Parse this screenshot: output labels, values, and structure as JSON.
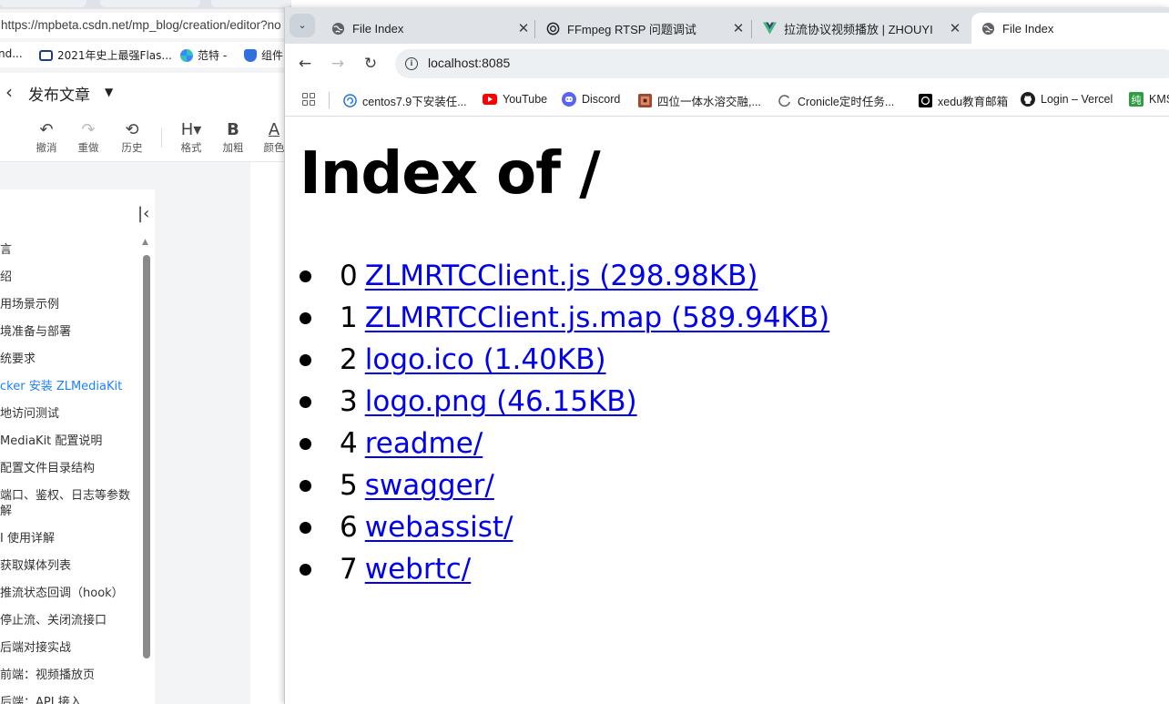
{
  "background_window": {
    "url": "https://mpbeta.csdn.net/mp_blog/creation/editor?no",
    "bookmarks": [
      {
        "label": "nd...",
        "icon": "bookmark-icon"
      },
      {
        "label": "2021年史上最强Flas...",
        "icon": "bilibili-icon"
      },
      {
        "label": "范特 -",
        "icon": "pinwheel-icon"
      },
      {
        "label": "组件",
        "icon": "shield-icon"
      }
    ],
    "header": {
      "title": "发布文章"
    },
    "toolbar": [
      {
        "label": "撤消",
        "icon": "undo-icon",
        "glyph": "↶"
      },
      {
        "label": "重做",
        "icon": "redo-icon",
        "glyph": "↷"
      },
      {
        "label": "历史",
        "icon": "history-icon",
        "glyph": "⟲"
      },
      {
        "label": "格式",
        "icon": "heading-icon",
        "glyph": "H▾"
      },
      {
        "label": "加粗",
        "icon": "bold-icon",
        "glyph": "B"
      },
      {
        "label": "颜色",
        "icon": "font-color-icon",
        "glyph": "A"
      }
    ],
    "outline": [
      "言",
      "绍",
      "用场景示例",
      "境准备与部署",
      "统要求",
      "cker 安装 ZLMediaKit",
      "地访问测试",
      "MediaKit 配置说明",
      "配置文件目录结构",
      "端口、鉴权、日志等参数解",
      "I 使用详解",
      "获取媒体列表",
      "推流状态回调（hook）",
      "停止流、关闭流接口",
      "后端对接实战",
      "前端：视频播放页",
      "后端：API 接入"
    ],
    "outline_active_index": 5
  },
  "browser": {
    "tabs": [
      {
        "title": "File Index",
        "icon": "globe-icon",
        "active": false
      },
      {
        "title": "FFmpeg RTSP 问题调试",
        "icon": "openai-icon",
        "active": false
      },
      {
        "title": "拉流协议视频播放 | ZHOUYI",
        "icon": "vue-icon",
        "active": false
      },
      {
        "title": "File Index",
        "icon": "globe-icon",
        "active": true
      }
    ],
    "url": "localhost:8085",
    "bookmarks": [
      {
        "label": "centos7.9下安装任...",
        "icon": "centos-icon"
      },
      {
        "label": "YouTube",
        "icon": "youtube-icon"
      },
      {
        "label": "Discord",
        "icon": "discord-icon"
      },
      {
        "label": "四位一体水溶交融,...",
        "icon": "image-icon"
      },
      {
        "label": "Cronicle定时任务...",
        "icon": "loading-icon"
      },
      {
        "label": "xedu教育邮箱",
        "icon": "openai-icon"
      },
      {
        "label": "Login – Vercel",
        "icon": "github-icon"
      },
      {
        "label": "KMS",
        "icon": "kms-icon"
      }
    ]
  },
  "page": {
    "heading": "Index of /",
    "files": [
      {
        "index": "0",
        "name": "ZLMRTCClient.js (298.98KB)"
      },
      {
        "index": "1",
        "name": "ZLMRTCClient.js.map (589.94KB)"
      },
      {
        "index": "2",
        "name": "logo.ico (1.40KB)"
      },
      {
        "index": "3",
        "name": "logo.png (46.15KB)"
      },
      {
        "index": "4",
        "name": "readme/"
      },
      {
        "index": "5",
        "name": "swagger/"
      },
      {
        "index": "6",
        "name": "webassist/"
      },
      {
        "index": "7",
        "name": "webrtc/"
      }
    ]
  },
  "colors": {
    "link": "#0000ee",
    "outline_active": "#1e80ff",
    "youtube": "#ff0000",
    "discord": "#5865f2",
    "vue": "#41b883"
  }
}
